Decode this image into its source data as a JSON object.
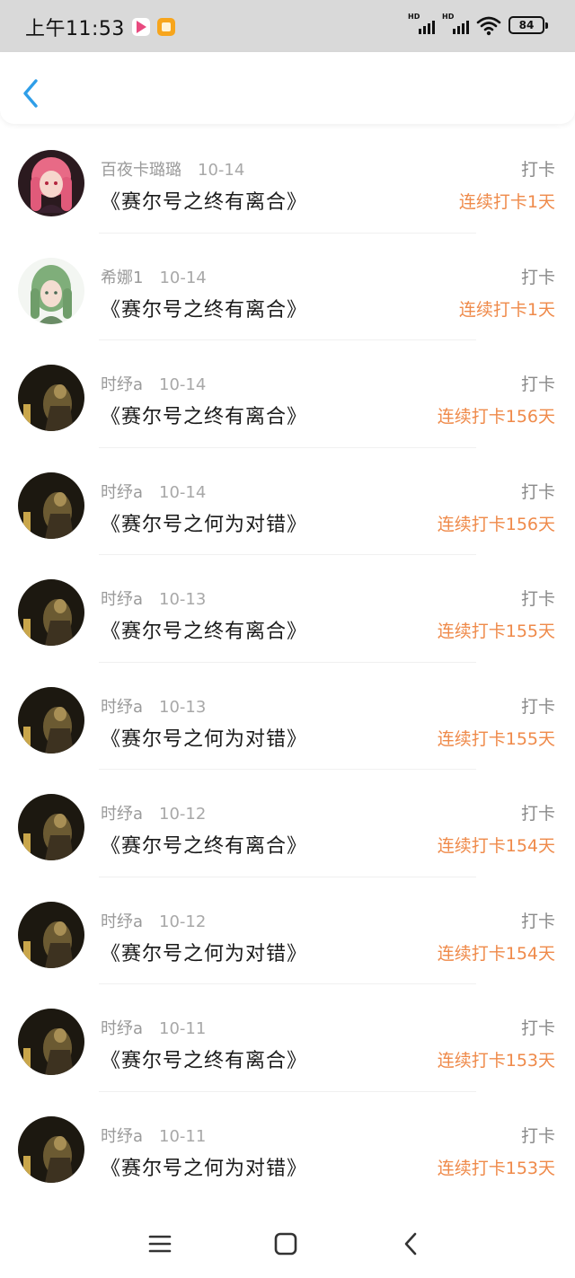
{
  "status_bar": {
    "time": "上午11:53",
    "apps": [
      "video-app-icon",
      "reader-app-icon"
    ],
    "signal_labels": [
      "HD",
      "HD"
    ],
    "battery": "84"
  },
  "header": {
    "back_icon": "chevron-left-icon"
  },
  "feed": [
    {
      "avatar": "pink-hair-girl-avatar",
      "user": "百夜卡璐璐",
      "date": "10-14",
      "title": "《赛尔号之终有离合》",
      "action": "打卡",
      "streak": "连续打卡1天"
    },
    {
      "avatar": "green-hair-elf-avatar",
      "user": "希娜1",
      "date": "10-14",
      "title": "《赛尔号之终有离合》",
      "action": "打卡",
      "streak": "连续打卡1天"
    },
    {
      "avatar": "dark-figure-avatar",
      "user": "时纾a",
      "date": "10-14",
      "title": "《赛尔号之终有离合》",
      "action": "打卡",
      "streak": "连续打卡156天"
    },
    {
      "avatar": "dark-figure-avatar",
      "user": "时纾a",
      "date": "10-14",
      "title": "《赛尔号之何为对错》",
      "action": "打卡",
      "streak": "连续打卡156天"
    },
    {
      "avatar": "dark-figure-avatar",
      "user": "时纾a",
      "date": "10-13",
      "title": "《赛尔号之终有离合》",
      "action": "打卡",
      "streak": "连续打卡155天"
    },
    {
      "avatar": "dark-figure-avatar",
      "user": "时纾a",
      "date": "10-13",
      "title": "《赛尔号之何为对错》",
      "action": "打卡",
      "streak": "连续打卡155天"
    },
    {
      "avatar": "dark-figure-avatar",
      "user": "时纾a",
      "date": "10-12",
      "title": "《赛尔号之终有离合》",
      "action": "打卡",
      "streak": "连续打卡154天"
    },
    {
      "avatar": "dark-figure-avatar",
      "user": "时纾a",
      "date": "10-12",
      "title": "《赛尔号之何为对错》",
      "action": "打卡",
      "streak": "连续打卡154天"
    },
    {
      "avatar": "dark-figure-avatar",
      "user": "时纾a",
      "date": "10-11",
      "title": "《赛尔号之终有离合》",
      "action": "打卡",
      "streak": "连续打卡153天"
    },
    {
      "avatar": "dark-figure-avatar",
      "user": "时纾a",
      "date": "10-11",
      "title": "《赛尔号之何为对错》",
      "action": "打卡",
      "streak": "连续打卡153天"
    }
  ],
  "nav_bar": {
    "icons": [
      "menu-icon",
      "home-icon",
      "back-icon"
    ]
  },
  "colors": {
    "accent": "#2f9ee8",
    "streak": "#ef8a4a",
    "status_bg": "#d9d9d9"
  }
}
